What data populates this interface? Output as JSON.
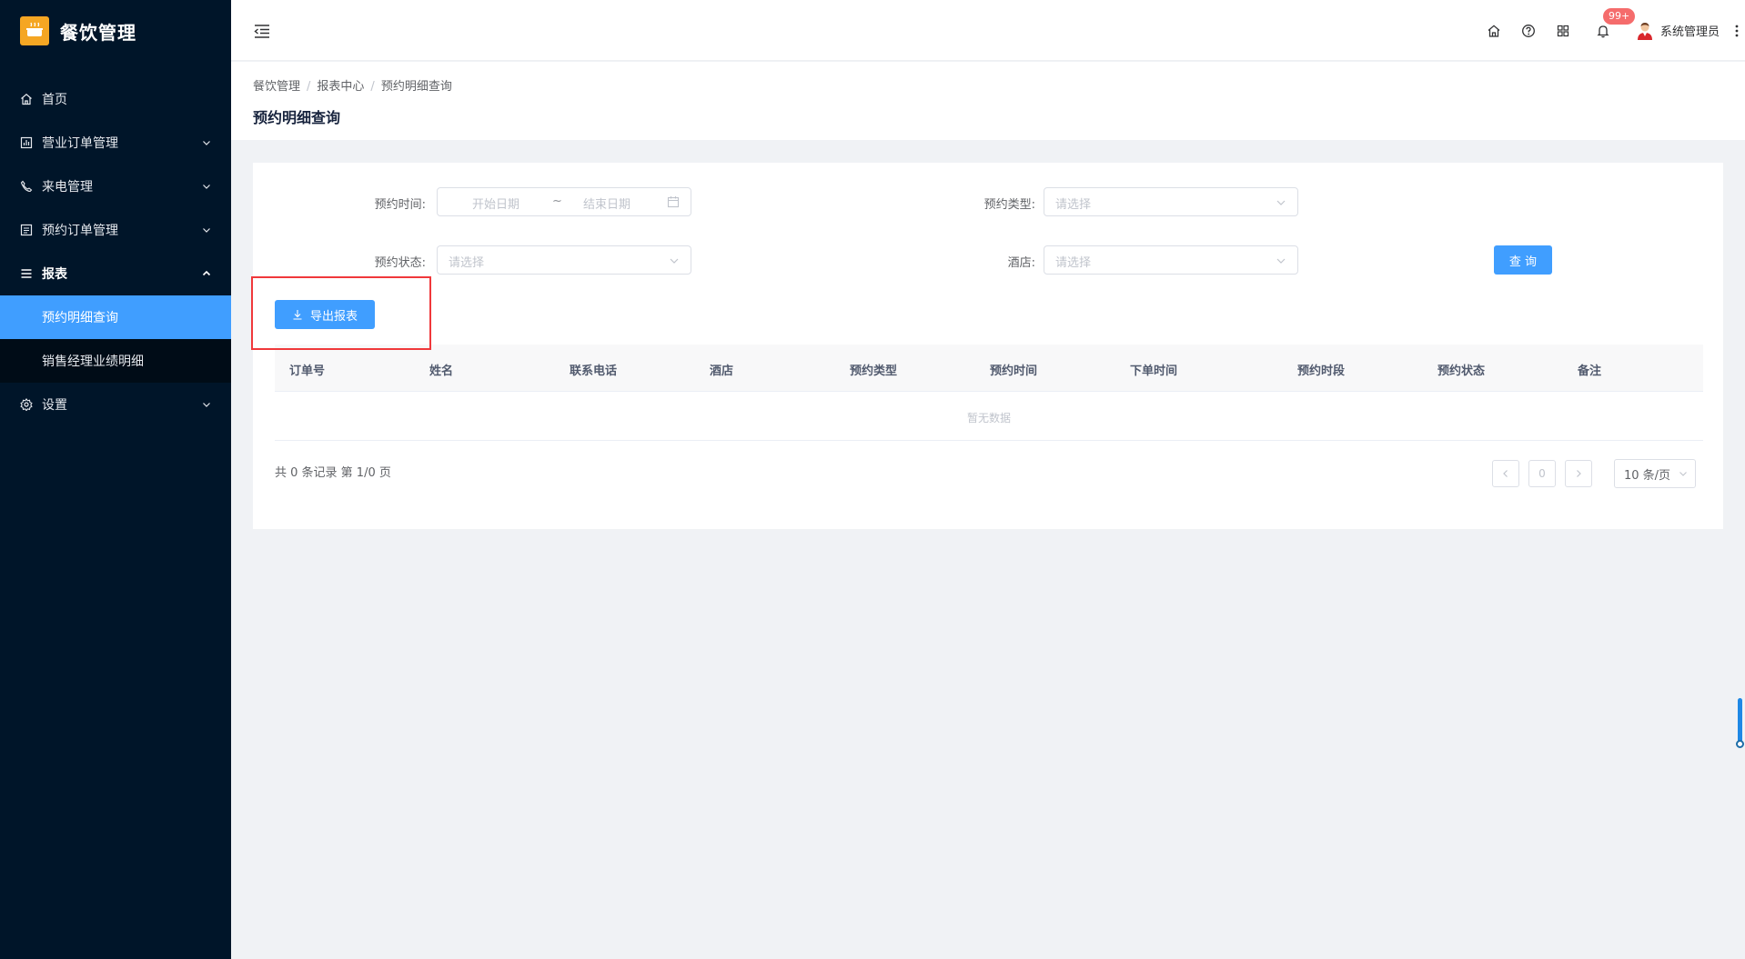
{
  "app": {
    "title": "餐饮管理",
    "brand_color": "#f5a623",
    "sidebar_bg": "#001529",
    "accent": "#409eff"
  },
  "sidebar": {
    "items": [
      {
        "label": "首页",
        "icon": "home-icon"
      },
      {
        "label": "营业订单管理",
        "icon": "chart-icon"
      },
      {
        "label": "来电管理",
        "icon": "phone-icon"
      },
      {
        "label": "预约订单管理",
        "icon": "list-icon"
      },
      {
        "label": "报表",
        "icon": "menu-icon"
      },
      {
        "label": "设置",
        "icon": "gear-icon"
      }
    ],
    "report_sub": [
      {
        "label": "预约明细查询"
      },
      {
        "label": "销售经理业绩明细"
      }
    ]
  },
  "header": {
    "badge": "99+",
    "username": "系统管理员"
  },
  "breadcrumb": [
    "餐饮管理",
    "报表中心",
    "预约明细查询"
  ],
  "page_title": "预约明细查询",
  "form": {
    "time_label": "预约时间:",
    "start_placeholder": "开始日期",
    "range_sep": "~",
    "end_placeholder": "结束日期",
    "type_label": "预约类型:",
    "type_placeholder": "请选择",
    "status_label": "预约状态:",
    "status_placeholder": "请选择",
    "hotel_label": "酒店:",
    "hotel_placeholder": "请选择",
    "query_button": "查 询",
    "export_button": "导出报表"
  },
  "table": {
    "columns": [
      "订单号",
      "姓名",
      "联系电话",
      "酒店",
      "预约类型",
      "预约时间",
      "下单时间",
      "预约时段",
      "预约状态",
      "备注"
    ],
    "empty_text": "暂无数据"
  },
  "pagination": {
    "summary": "共 0 条记录 第 1/0 页",
    "current_page": "0",
    "page_size": "10 条/页"
  }
}
